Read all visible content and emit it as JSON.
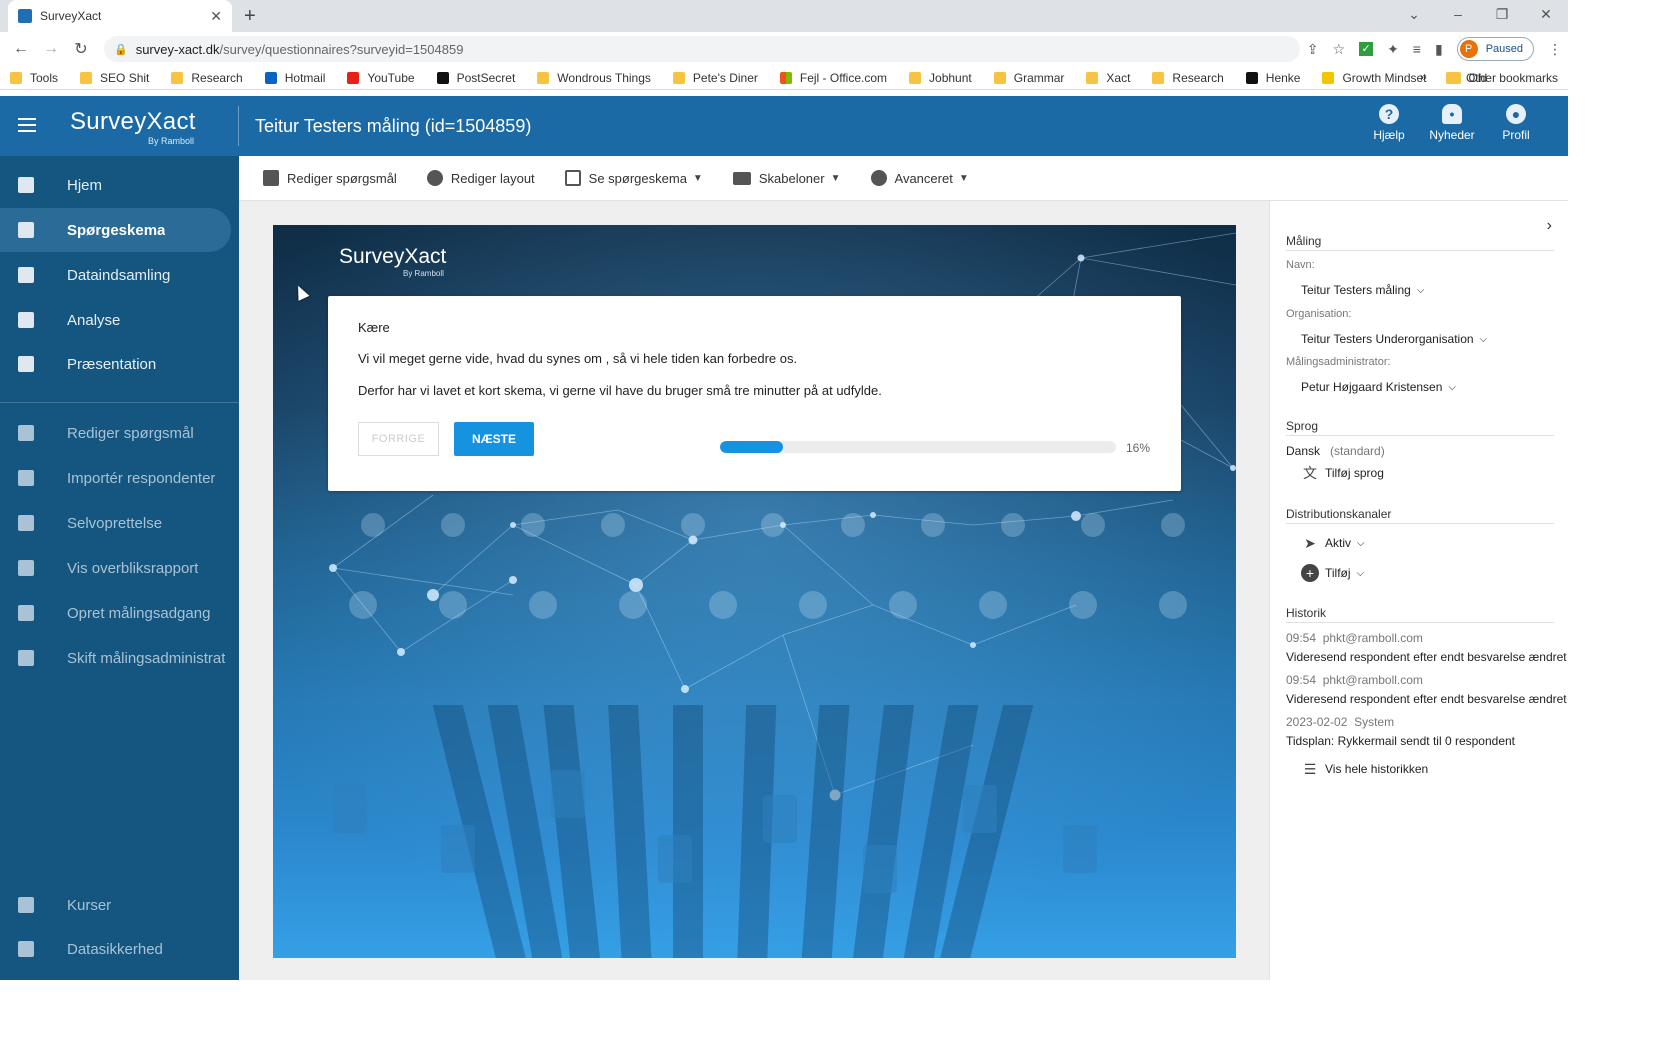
{
  "browser": {
    "tab_title": "SurveyXact",
    "url_host": "survey-xact.dk",
    "url_path": "/survey/questionnaires?surveyid=1504859",
    "profile_status": "Paused",
    "profile_initial": "P",
    "bookmarks": [
      "Tools",
      "SEO Shit",
      "Research",
      "Hotmail",
      "YouTube",
      "PostSecret",
      "Wondrous Things",
      "Pete's Diner",
      "Fejl - Office.com",
      "Jobhunt",
      "Grammar",
      "Xact",
      "Research",
      "Henke",
      "Growth Mindset",
      "Old"
    ],
    "bookmarks_more": "»",
    "other_bookmarks": "Other bookmarks"
  },
  "app": {
    "logo": "SurveyXact",
    "logo_sub": "By Ramboll",
    "title": "Teitur Testers måling (id=1504859)",
    "header_buttons": {
      "help": "Hjælp",
      "news": "Nyheder",
      "profile": "Profil"
    }
  },
  "sidebar": {
    "items": [
      {
        "label": "Hjem"
      },
      {
        "label": "Spørgeskema"
      },
      {
        "label": "Dataindsamling"
      },
      {
        "label": "Analyse"
      },
      {
        "label": "Præsentation"
      },
      {
        "label": "Rediger spørgsmål"
      },
      {
        "label": "Importér respondenter"
      },
      {
        "label": "Selvoprettelse"
      },
      {
        "label": "Vis overbliksrapport"
      },
      {
        "label": "Opret målingsadgang"
      },
      {
        "label": "Skift målingsadministrat"
      },
      {
        "label": "Kurser"
      },
      {
        "label": "Datasikkerhed"
      }
    ]
  },
  "toolbar": {
    "edit_questions": "Rediger spørgsmål",
    "edit_layout": "Rediger layout",
    "view_questionnaire": "Se spørgeskema",
    "templates": "Skabeloner",
    "advanced": "Avanceret"
  },
  "preview": {
    "logo": "SurveyXact",
    "logo_sub": "By Ramboll",
    "greeting": "Kære",
    "line1": "Vi vil meget gerne vide, hvad du synes om , så vi hele tiden kan forbedre os.",
    "line2": "Derfor har vi lavet et kort skema, vi gerne vil have du bruger små tre minutter på at udfylde.",
    "prev_button": "FORRIGE",
    "next_button": "NÆSTE",
    "progress_fraction": 0.16,
    "progress_label": "16%"
  },
  "panel": {
    "measurement_heading": "Måling",
    "name_label": "Navn:",
    "name_value": "Teitur Testers måling",
    "org_label": "Organisation:",
    "org_value": "Teitur Testers Underorganisation",
    "admin_label": "Målingsadministrator:",
    "admin_value": "Petur Højgaard Kristensen",
    "language_heading": "Sprog",
    "language_value": "Dansk",
    "language_default": "(standard)",
    "add_language": "Tilføj sprog",
    "channels_heading": "Distributionskanaler",
    "active_channel": "Aktiv",
    "add_channel": "Tilføj",
    "history_heading": "Historik",
    "history": [
      {
        "time": "09:54",
        "who": "phkt@ramboll.com",
        "text": "Videresend respondent efter endt besvarelse ændret"
      },
      {
        "time": "09:54",
        "who": "phkt@ramboll.com",
        "text": "Videresend respondent efter endt besvarelse ændret"
      },
      {
        "time": "2023-02-02",
        "who": "System",
        "text": "Tidsplan: Rykkermail sendt til 0 respondent"
      }
    ],
    "view_history": "Vis hele historikken"
  },
  "colors": {
    "header_blue": "#1b6aa6",
    "sidebar_blue": "#14567f",
    "accent": "#1592e0"
  }
}
